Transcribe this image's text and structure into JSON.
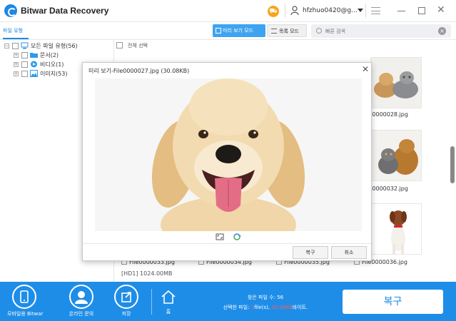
{
  "app": {
    "title": "Bitwar Data Recovery",
    "user": "hfzhuo0420@g..."
  },
  "toolbar": {
    "tab_filetype": "파일 유형",
    "preview_mode": "미리 보기 모드",
    "list_mode": "목록 모드",
    "search_placeholder": "빠른 검색"
  },
  "tree": {
    "items": [
      {
        "label": "모든 파일 유형(56)",
        "icon": "computer-icon"
      },
      {
        "label": "문서(2)",
        "icon": "folder-icon"
      },
      {
        "label": "비디오(1)",
        "icon": "play-icon"
      },
      {
        "label": "이미지(53)",
        "icon": "image-icon"
      }
    ]
  },
  "grid": {
    "select_all": "전체 선택",
    "files": [
      "File0000028.jpg",
      "File0000032.jpg",
      "File0000033.jpg",
      "File0000034.jpg",
      "File0000035.jpg",
      "File0000036.jpg"
    ]
  },
  "status": {
    "disk": "[HD1] 1024.00MB"
  },
  "modal": {
    "title": "미리 보기-File0000027.jpg (30.08KB)",
    "ok": "복구",
    "cancel": "취소"
  },
  "bottom": {
    "mobile": "모바일용 Bitwar",
    "online": "온라인 문의",
    "save": "저장",
    "home": "홈",
    "found_label": "찾은 파일 수: 56",
    "selected_prefix": "선택한 파일: ",
    "selected_count": "1",
    "selected_mid": "file(s), ",
    "selected_size": "30.08KB",
    "selected_suffix": "바이트.",
    "recover": "복구"
  },
  "colors": {
    "accent": "#1e8de8",
    "cart": "#f7a51c"
  }
}
